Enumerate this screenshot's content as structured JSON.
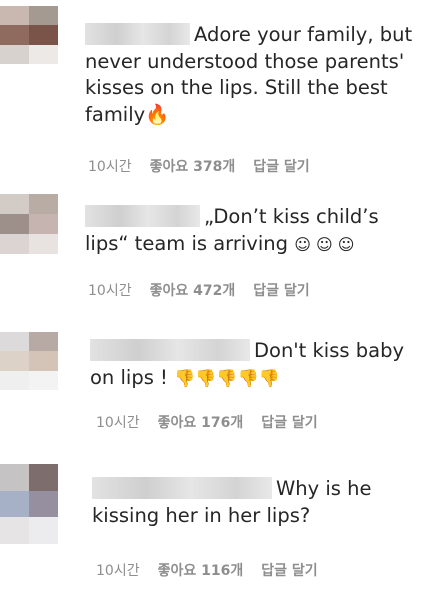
{
  "comments": [
    {
      "text": "Adore your family, but never understood those parents' kisses on the lips. Still the best family",
      "emoji": "🔥",
      "time": "10시간",
      "likes": "좋아요 378개",
      "reply": "답글 달기"
    },
    {
      "text": "„Don’t kiss child’s lips“ team is arriving",
      "emoji": "☺ ☺ ☺",
      "time": "10시간",
      "likes": "좋아요 472개",
      "reply": "답글 달기"
    },
    {
      "text": "Don't kiss baby on lips !",
      "emoji": "👎👎👎👎👎",
      "time": "10시간",
      "likes": "좋아요 176개",
      "reply": "답글 달기"
    },
    {
      "text": "Why is he kissing her in her lips?",
      "emoji": "",
      "time": "10시간",
      "likes": "좋아요 116개",
      "reply": "답글 달기"
    }
  ]
}
